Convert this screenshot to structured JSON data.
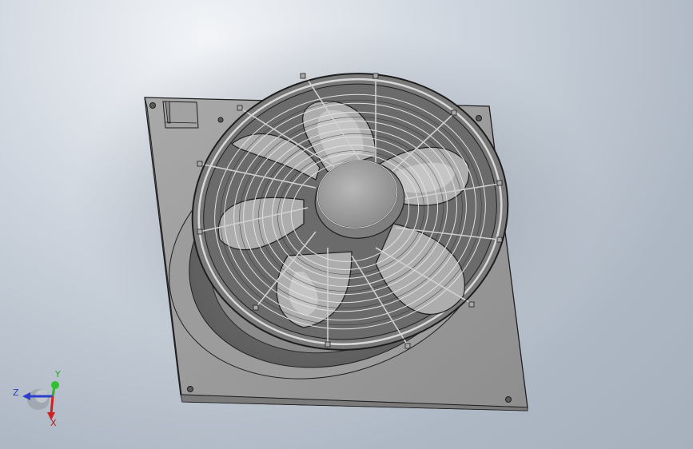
{
  "scene": {
    "model_description": "axial-fan-assembly",
    "background_colors": [
      "#f2f4f7",
      "#cdd4dd",
      "#a6b1bd"
    ],
    "part_color": "#9a9a9a"
  },
  "triad": {
    "y_label": "Y",
    "z_label": "Z",
    "x_label": "X",
    "y_color": "#30b030",
    "z_color": "#2a3fd0",
    "x_color": "#d02020"
  }
}
